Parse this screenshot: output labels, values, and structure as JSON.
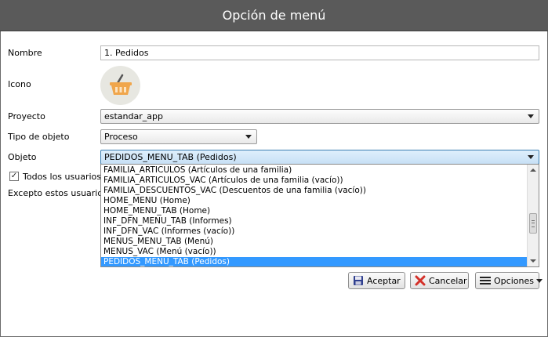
{
  "window": {
    "title": "Opción de menú"
  },
  "form": {
    "nombre_label": "Nombre",
    "nombre_value": "1. Pedidos",
    "icono_label": "Icono",
    "proyecto_label": "Proyecto",
    "proyecto_value": "estandar_app",
    "tipo_label": "Tipo de objeto",
    "tipo_value": "Proceso",
    "objeto_label": "Objeto",
    "objeto_value": "PEDIDOS_MENU_TAB  (Pedidos)",
    "todos_label": "Todos los usuarios",
    "todos_checked": true,
    "excepto_label": "Excepto estos usuarios"
  },
  "dropdown": {
    "items": [
      "FAMILIA_ARTICULOS  (Artículos de una familia)",
      "FAMILIA_ARTICULOS_VAC  (Artículos de una familia (vacío))",
      "FAMILIA_DESCUENTOS_VAC  (Descuentos de una familia (vacío))",
      "HOME_MENU  (Home)",
      "HOME_MENU_TAB  (Home)",
      "INF_DFN_MENU_TAB  (Informes)",
      "INF_DFN_VAC  (Informes (vacío))",
      "MENUS_MENU_TAB  (Menú)",
      "MENUS_VAC  (Menú (vacío))",
      "PEDIDOS_MENU_TAB  (Pedidos)"
    ],
    "selected_index": 9
  },
  "buttons": {
    "accept": "Aceptar",
    "cancel": "Cancelar",
    "options": "Opciones"
  },
  "icons": {
    "basket": "basket-icon",
    "save": "save-icon",
    "cancel": "cancel-x-icon",
    "menu": "hamburger-menu-icon"
  },
  "colors": {
    "titlebar": "#5a5a5a",
    "selection": "#3399ff",
    "basket": "#f0a64c"
  }
}
